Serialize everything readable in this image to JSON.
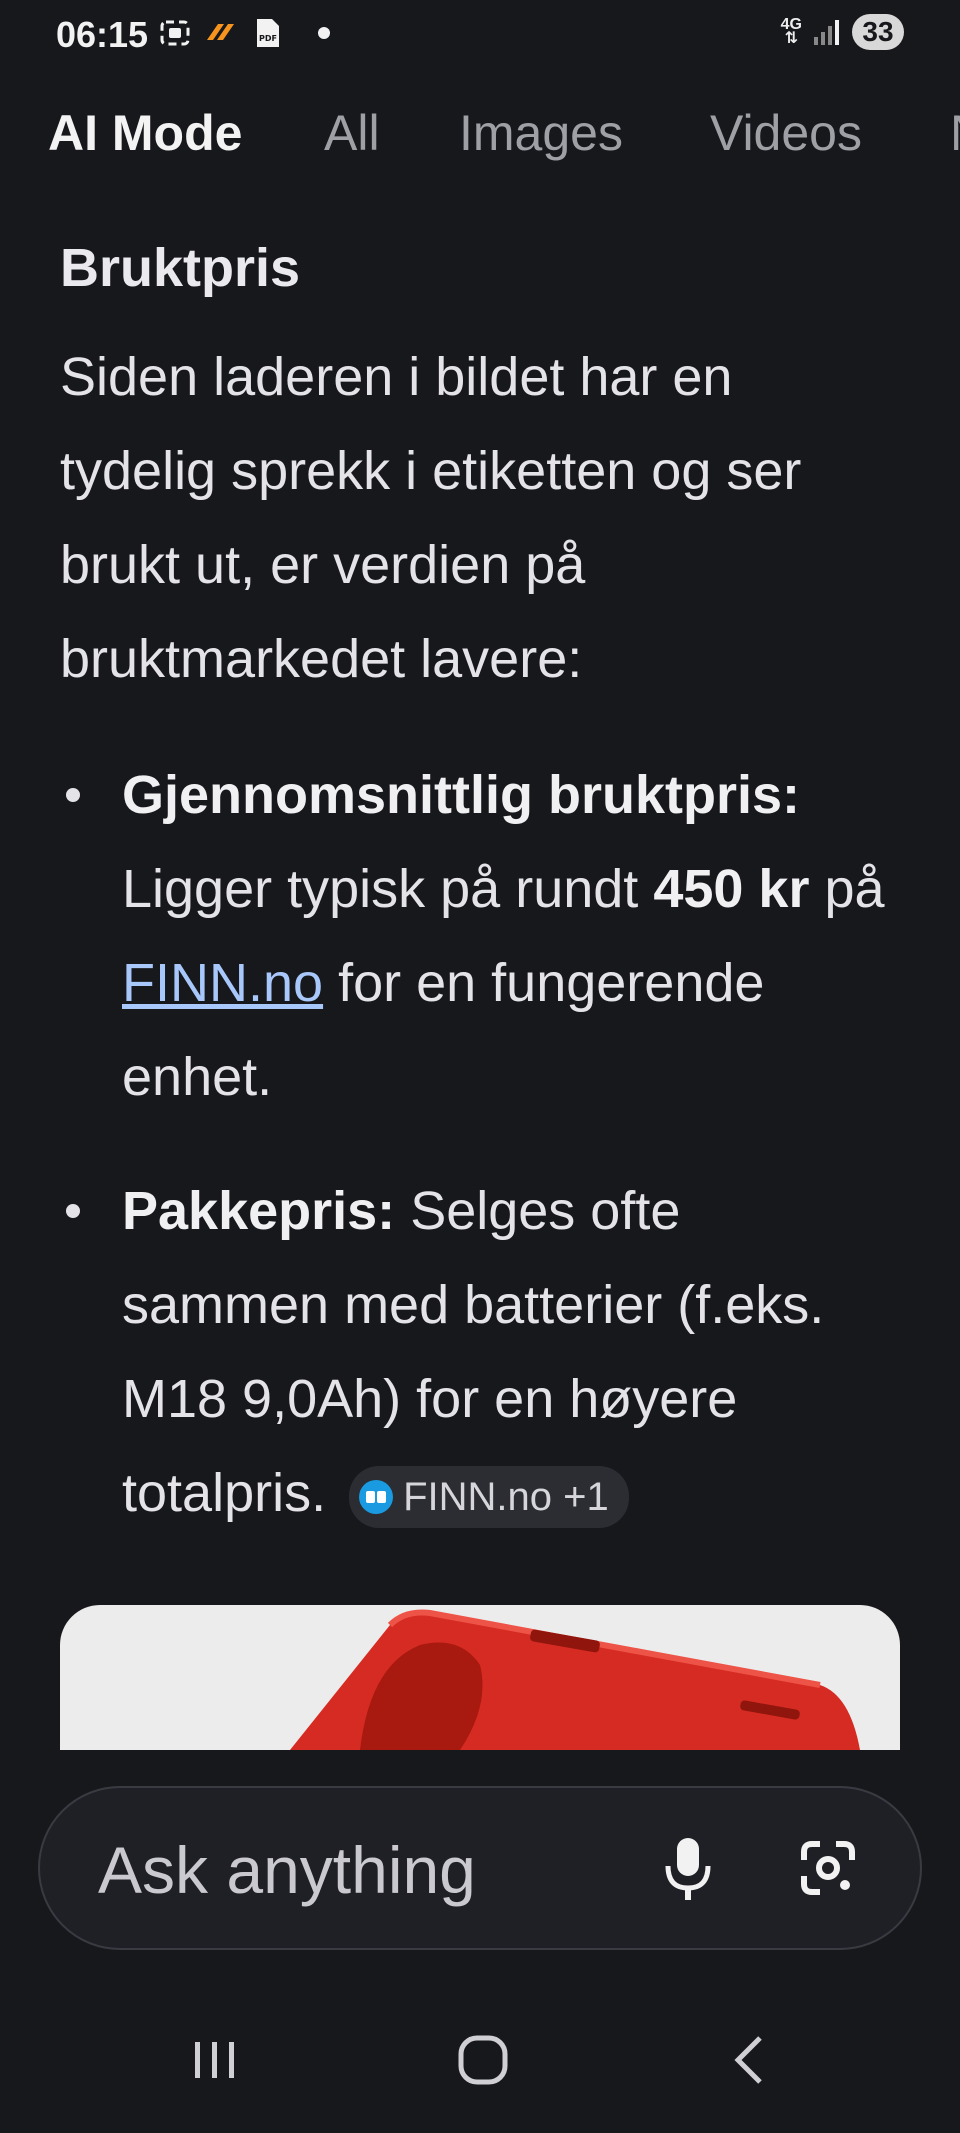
{
  "status_bar": {
    "time": "06:15",
    "network": "4G",
    "battery": "33",
    "icons": [
      "screenshot-icon",
      "app-notification-icon",
      "pdf-icon",
      "notification-dot"
    ]
  },
  "tabs": [
    {
      "label": "AI Mode",
      "active": true
    },
    {
      "label": "All",
      "active": false
    },
    {
      "label": "Images",
      "active": false
    },
    {
      "label": "Videos",
      "active": false
    },
    {
      "label": "N",
      "active": false
    }
  ],
  "content": {
    "heading": "Bruktpris",
    "paragraph": "Siden laderen i bildet har en tydelig sprekk i etiketten og ser brukt ut, er verdien på bruktmarkedet lavere:",
    "bullet1": {
      "label": "Gjennomsnittlig bruktpris:",
      "text_before": "Ligger typisk på rundt",
      "price": "450 kr",
      "text_mid": "på",
      "link": "FINN.no",
      "text_after": "for en fungerende enhet."
    },
    "bullet2": {
      "label": "Pakkepris:",
      "text": "Selges ofte sammen med batterier (f.eks. M18 9,0Ah) for en høyere totalpris.",
      "source_chip": "FINN.no +1"
    }
  },
  "input": {
    "placeholder": "Ask anything"
  },
  "colors": {
    "background": "#17181c",
    "link": "#a8c7fa",
    "product_red": "#d62b22"
  }
}
